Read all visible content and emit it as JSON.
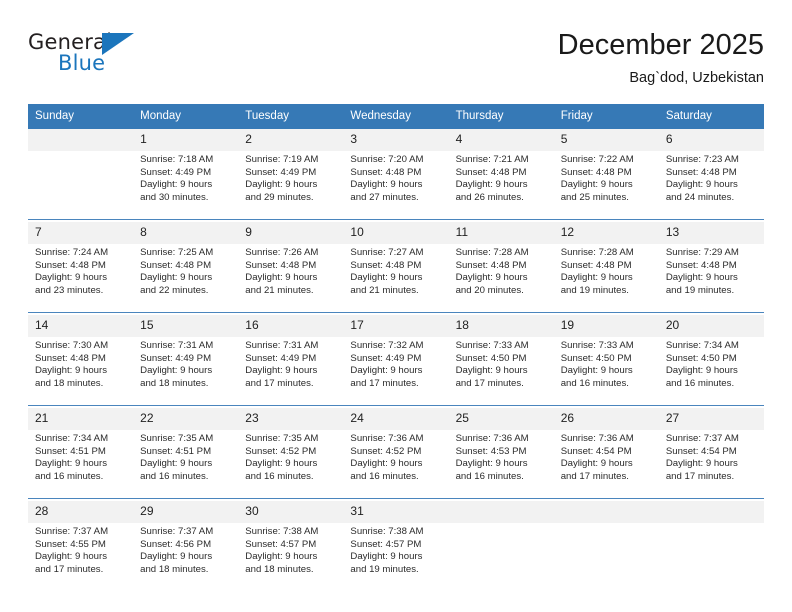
{
  "brand": {
    "name_top": "General",
    "name_bottom": "Blue",
    "accent_color": "#1b75bc",
    "text_color": "#231f20"
  },
  "header": {
    "title": "December 2025",
    "subtitle": "Bag`dod, Uzbekistan"
  },
  "calendar": {
    "header_bg": "#3679b6",
    "header_text_color": "#ffffff",
    "daynum_band_bg": "#f2f2f2",
    "week_rule_color": "#4a85bd",
    "weekday_headers": [
      "Sunday",
      "Monday",
      "Tuesday",
      "Wednesday",
      "Thursday",
      "Friday",
      "Saturday"
    ],
    "weeks": [
      {
        "days": [
          {
            "num": "",
            "sunrise": "",
            "sunset": "",
            "daylight1": "",
            "daylight2": ""
          },
          {
            "num": "1",
            "sunrise": "Sunrise: 7:18 AM",
            "sunset": "Sunset: 4:49 PM",
            "daylight1": "Daylight: 9 hours",
            "daylight2": "and 30 minutes."
          },
          {
            "num": "2",
            "sunrise": "Sunrise: 7:19 AM",
            "sunset": "Sunset: 4:49 PM",
            "daylight1": "Daylight: 9 hours",
            "daylight2": "and 29 minutes."
          },
          {
            "num": "3",
            "sunrise": "Sunrise: 7:20 AM",
            "sunset": "Sunset: 4:48 PM",
            "daylight1": "Daylight: 9 hours",
            "daylight2": "and 27 minutes."
          },
          {
            "num": "4",
            "sunrise": "Sunrise: 7:21 AM",
            "sunset": "Sunset: 4:48 PM",
            "daylight1": "Daylight: 9 hours",
            "daylight2": "and 26 minutes."
          },
          {
            "num": "5",
            "sunrise": "Sunrise: 7:22 AM",
            "sunset": "Sunset: 4:48 PM",
            "daylight1": "Daylight: 9 hours",
            "daylight2": "and 25 minutes."
          },
          {
            "num": "6",
            "sunrise": "Sunrise: 7:23 AM",
            "sunset": "Sunset: 4:48 PM",
            "daylight1": "Daylight: 9 hours",
            "daylight2": "and 24 minutes."
          }
        ]
      },
      {
        "days": [
          {
            "num": "7",
            "sunrise": "Sunrise: 7:24 AM",
            "sunset": "Sunset: 4:48 PM",
            "daylight1": "Daylight: 9 hours",
            "daylight2": "and 23 minutes."
          },
          {
            "num": "8",
            "sunrise": "Sunrise: 7:25 AM",
            "sunset": "Sunset: 4:48 PM",
            "daylight1": "Daylight: 9 hours",
            "daylight2": "and 22 minutes."
          },
          {
            "num": "9",
            "sunrise": "Sunrise: 7:26 AM",
            "sunset": "Sunset: 4:48 PM",
            "daylight1": "Daylight: 9 hours",
            "daylight2": "and 21 minutes."
          },
          {
            "num": "10",
            "sunrise": "Sunrise: 7:27 AM",
            "sunset": "Sunset: 4:48 PM",
            "daylight1": "Daylight: 9 hours",
            "daylight2": "and 21 minutes."
          },
          {
            "num": "11",
            "sunrise": "Sunrise: 7:28 AM",
            "sunset": "Sunset: 4:48 PM",
            "daylight1": "Daylight: 9 hours",
            "daylight2": "and 20 minutes."
          },
          {
            "num": "12",
            "sunrise": "Sunrise: 7:28 AM",
            "sunset": "Sunset: 4:48 PM",
            "daylight1": "Daylight: 9 hours",
            "daylight2": "and 19 minutes."
          },
          {
            "num": "13",
            "sunrise": "Sunrise: 7:29 AM",
            "sunset": "Sunset: 4:48 PM",
            "daylight1": "Daylight: 9 hours",
            "daylight2": "and 19 minutes."
          }
        ]
      },
      {
        "days": [
          {
            "num": "14",
            "sunrise": "Sunrise: 7:30 AM",
            "sunset": "Sunset: 4:48 PM",
            "daylight1": "Daylight: 9 hours",
            "daylight2": "and 18 minutes."
          },
          {
            "num": "15",
            "sunrise": "Sunrise: 7:31 AM",
            "sunset": "Sunset: 4:49 PM",
            "daylight1": "Daylight: 9 hours",
            "daylight2": "and 18 minutes."
          },
          {
            "num": "16",
            "sunrise": "Sunrise: 7:31 AM",
            "sunset": "Sunset: 4:49 PM",
            "daylight1": "Daylight: 9 hours",
            "daylight2": "and 17 minutes."
          },
          {
            "num": "17",
            "sunrise": "Sunrise: 7:32 AM",
            "sunset": "Sunset: 4:49 PM",
            "daylight1": "Daylight: 9 hours",
            "daylight2": "and 17 minutes."
          },
          {
            "num": "18",
            "sunrise": "Sunrise: 7:33 AM",
            "sunset": "Sunset: 4:50 PM",
            "daylight1": "Daylight: 9 hours",
            "daylight2": "and 17 minutes."
          },
          {
            "num": "19",
            "sunrise": "Sunrise: 7:33 AM",
            "sunset": "Sunset: 4:50 PM",
            "daylight1": "Daylight: 9 hours",
            "daylight2": "and 16 minutes."
          },
          {
            "num": "20",
            "sunrise": "Sunrise: 7:34 AM",
            "sunset": "Sunset: 4:50 PM",
            "daylight1": "Daylight: 9 hours",
            "daylight2": "and 16 minutes."
          }
        ]
      },
      {
        "days": [
          {
            "num": "21",
            "sunrise": "Sunrise: 7:34 AM",
            "sunset": "Sunset: 4:51 PM",
            "daylight1": "Daylight: 9 hours",
            "daylight2": "and 16 minutes."
          },
          {
            "num": "22",
            "sunrise": "Sunrise: 7:35 AM",
            "sunset": "Sunset: 4:51 PM",
            "daylight1": "Daylight: 9 hours",
            "daylight2": "and 16 minutes."
          },
          {
            "num": "23",
            "sunrise": "Sunrise: 7:35 AM",
            "sunset": "Sunset: 4:52 PM",
            "daylight1": "Daylight: 9 hours",
            "daylight2": "and 16 minutes."
          },
          {
            "num": "24",
            "sunrise": "Sunrise: 7:36 AM",
            "sunset": "Sunset: 4:52 PM",
            "daylight1": "Daylight: 9 hours",
            "daylight2": "and 16 minutes."
          },
          {
            "num": "25",
            "sunrise": "Sunrise: 7:36 AM",
            "sunset": "Sunset: 4:53 PM",
            "daylight1": "Daylight: 9 hours",
            "daylight2": "and 16 minutes."
          },
          {
            "num": "26",
            "sunrise": "Sunrise: 7:36 AM",
            "sunset": "Sunset: 4:54 PM",
            "daylight1": "Daylight: 9 hours",
            "daylight2": "and 17 minutes."
          },
          {
            "num": "27",
            "sunrise": "Sunrise: 7:37 AM",
            "sunset": "Sunset: 4:54 PM",
            "daylight1": "Daylight: 9 hours",
            "daylight2": "and 17 minutes."
          }
        ]
      },
      {
        "days": [
          {
            "num": "28",
            "sunrise": "Sunrise: 7:37 AM",
            "sunset": "Sunset: 4:55 PM",
            "daylight1": "Daylight: 9 hours",
            "daylight2": "and 17 minutes."
          },
          {
            "num": "29",
            "sunrise": "Sunrise: 7:37 AM",
            "sunset": "Sunset: 4:56 PM",
            "daylight1": "Daylight: 9 hours",
            "daylight2": "and 18 minutes."
          },
          {
            "num": "30",
            "sunrise": "Sunrise: 7:38 AM",
            "sunset": "Sunset: 4:57 PM",
            "daylight1": "Daylight: 9 hours",
            "daylight2": "and 18 minutes."
          },
          {
            "num": "31",
            "sunrise": "Sunrise: 7:38 AM",
            "sunset": "Sunset: 4:57 PM",
            "daylight1": "Daylight: 9 hours",
            "daylight2": "and 19 minutes."
          },
          {
            "num": "",
            "sunrise": "",
            "sunset": "",
            "daylight1": "",
            "daylight2": ""
          },
          {
            "num": "",
            "sunrise": "",
            "sunset": "",
            "daylight1": "",
            "daylight2": ""
          },
          {
            "num": "",
            "sunrise": "",
            "sunset": "",
            "daylight1": "",
            "daylight2": ""
          }
        ]
      }
    ]
  }
}
